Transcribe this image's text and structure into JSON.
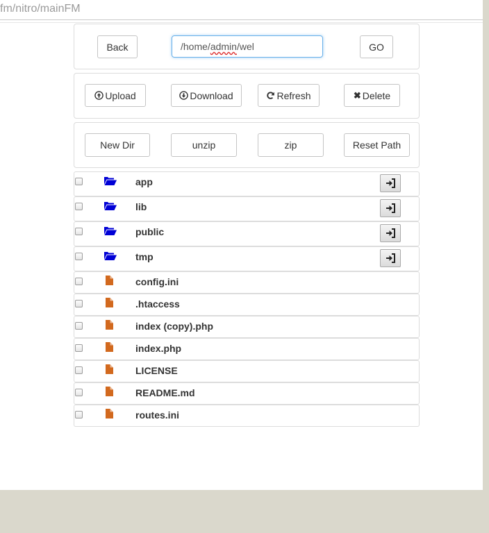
{
  "browser": {
    "url_text": "fm/nitro/mainFM"
  },
  "nav": {
    "back_label": "Back",
    "path_value_prefix": "/home/",
    "path_value_spell": "admin",
    "path_value_suffix": "/wel",
    "go_label": "GO"
  },
  "actions": {
    "upload_label": "Upload",
    "download_label": "Download",
    "refresh_label": "Refresh",
    "delete_label": "Delete",
    "upload_icon": "upload-circle-icon",
    "download_icon": "download-circle-icon",
    "refresh_icon": "refresh-icon",
    "delete_icon": "x-icon"
  },
  "tools": {
    "newdir_label": "New Dir",
    "unzip_label": "unzip",
    "zip_label": "zip",
    "reset_label": "Reset Path"
  },
  "colors": {
    "folder": "#0000d6",
    "file": "#d2691e",
    "focus": "#66afe9"
  },
  "files": [
    {
      "name": "app",
      "type": "folder",
      "icon": "folder-open-icon",
      "action_icon": "enter-icon"
    },
    {
      "name": "lib",
      "type": "folder",
      "icon": "folder-open-icon",
      "action_icon": "enter-icon"
    },
    {
      "name": "public",
      "type": "folder",
      "icon": "folder-open-icon",
      "action_icon": "enter-icon"
    },
    {
      "name": "tmp",
      "type": "folder",
      "icon": "folder-open-icon",
      "action_icon": "enter-icon"
    },
    {
      "name": "config.ini",
      "type": "file",
      "icon": "file-icon"
    },
    {
      "name": ".htaccess",
      "type": "file",
      "icon": "file-icon"
    },
    {
      "name": "index (copy).php",
      "type": "file",
      "icon": "file-icon"
    },
    {
      "name": "index.php",
      "type": "file",
      "icon": "file-icon"
    },
    {
      "name": "LICENSE",
      "type": "file",
      "icon": "file-icon"
    },
    {
      "name": "README.md",
      "type": "file",
      "icon": "file-icon"
    },
    {
      "name": "routes.ini",
      "type": "file",
      "icon": "file-icon"
    }
  ]
}
